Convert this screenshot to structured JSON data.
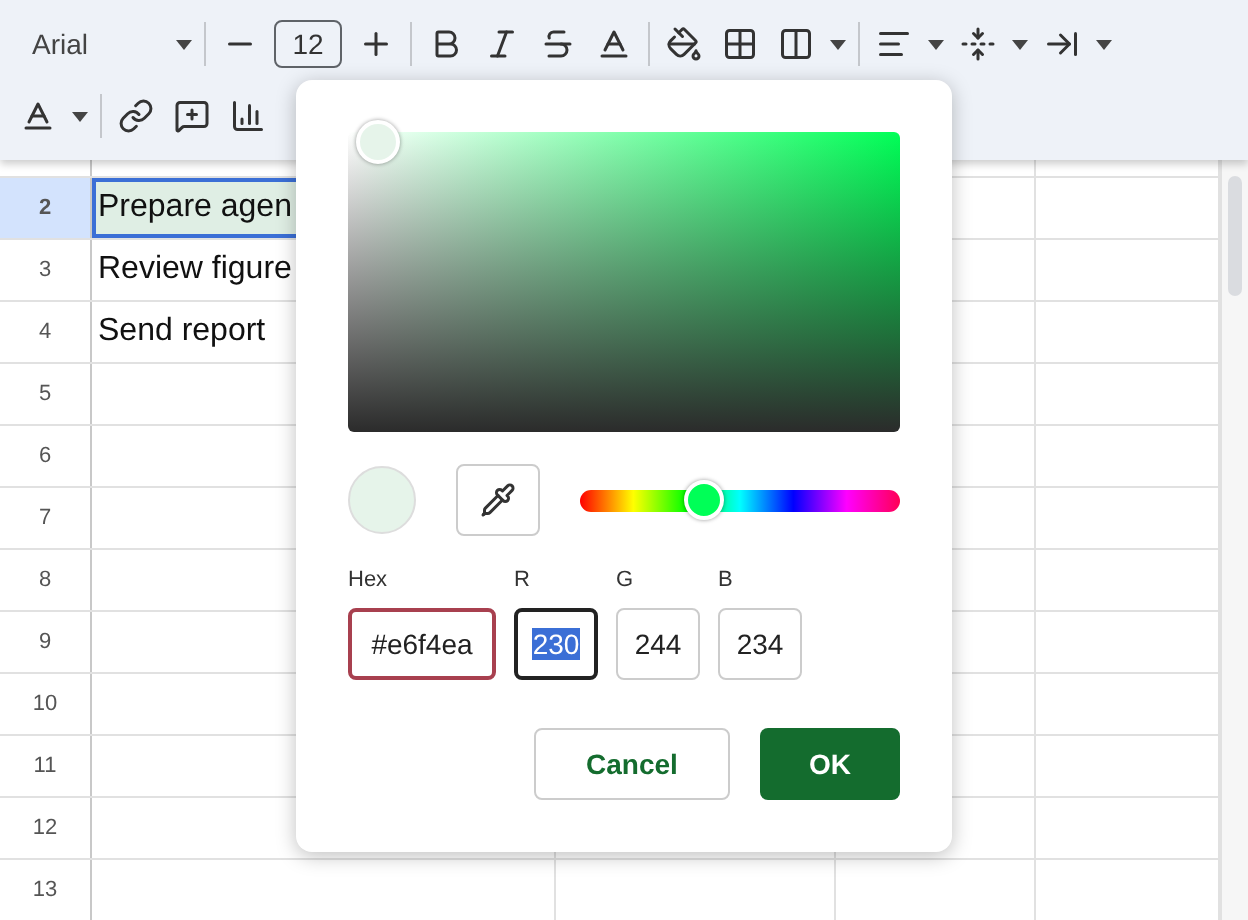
{
  "toolbar": {
    "font": "Arial",
    "font_size": "12"
  },
  "sheet": {
    "rows": [
      {
        "number": "2",
        "cell": "Prepare agen",
        "selected": true
      },
      {
        "number": "3",
        "cell": "Review figure",
        "selected": false
      },
      {
        "number": "4",
        "cell": "Send report",
        "selected": false
      },
      {
        "number": "5",
        "cell": "",
        "selected": false
      },
      {
        "number": "6",
        "cell": "",
        "selected": false
      },
      {
        "number": "7",
        "cell": "",
        "selected": false
      },
      {
        "number": "8",
        "cell": "",
        "selected": false
      },
      {
        "number": "9",
        "cell": "",
        "selected": false
      },
      {
        "number": "10",
        "cell": "",
        "selected": false
      },
      {
        "number": "11",
        "cell": "",
        "selected": false
      },
      {
        "number": "12",
        "cell": "",
        "selected": false
      },
      {
        "number": "13",
        "cell": "",
        "selected": false
      }
    ]
  },
  "color_dialog": {
    "hue": {
      "level": 0.39
    },
    "fields": [
      {
        "label": "Hex",
        "value": "#e6f4ea",
        "kind": "hex",
        "error": true,
        "focused": false
      },
      {
        "label": "R",
        "value": "230",
        "kind": "channel",
        "error": false,
        "focused": true
      },
      {
        "label": "G",
        "value": "244",
        "kind": "channel",
        "error": false,
        "focused": false
      },
      {
        "label": "B",
        "value": "234",
        "kind": "channel",
        "error": false,
        "focused": false
      }
    ],
    "buttons": [
      {
        "label": "Cancel",
        "kind": "secondary"
      },
      {
        "label": "OK",
        "kind": "primary"
      }
    ]
  }
}
